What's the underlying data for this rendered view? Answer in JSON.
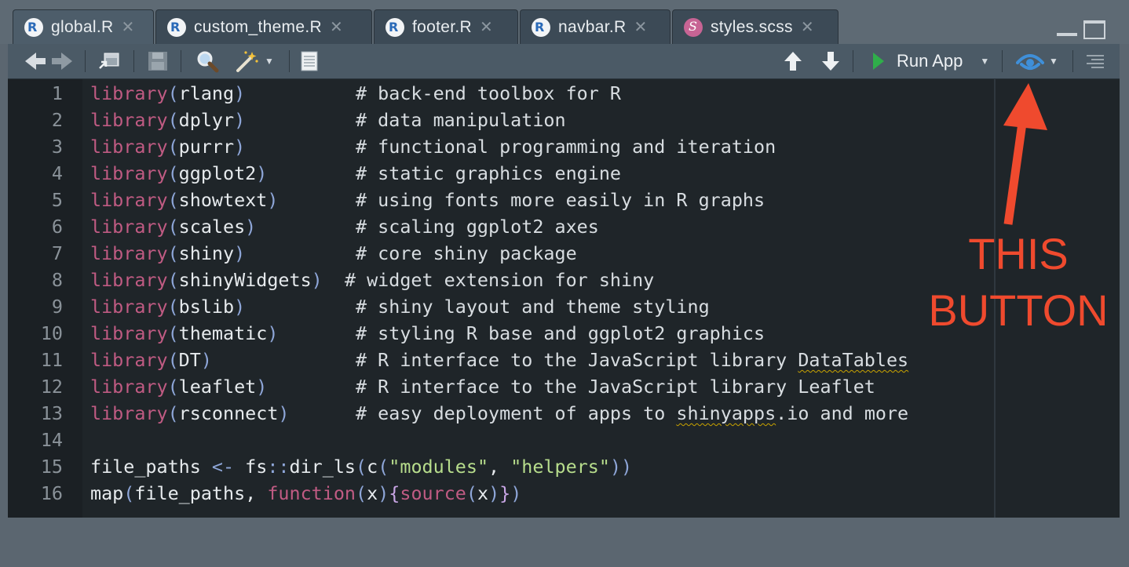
{
  "tabs": [
    {
      "label": "global.R",
      "icon": "r-file-icon",
      "active": true
    },
    {
      "label": "custom_theme.R",
      "icon": "r-file-icon",
      "active": false
    },
    {
      "label": "footer.R",
      "icon": "r-file-icon",
      "active": false
    },
    {
      "label": "navbar.R",
      "icon": "r-file-icon",
      "active": false
    },
    {
      "label": "styles.scss",
      "icon": "sass-file-icon",
      "active": false
    }
  ],
  "toolbar": {
    "run_label": "Run App"
  },
  "editor": {
    "lines": [
      {
        "n": "1",
        "pkg": "rlang",
        "pad": "          ",
        "comment": "# back-end toolbox for R"
      },
      {
        "n": "2",
        "pkg": "dplyr",
        "pad": "          ",
        "comment": "# data manipulation"
      },
      {
        "n": "3",
        "pkg": "purrr",
        "pad": "          ",
        "comment": "# functional programming and iteration"
      },
      {
        "n": "4",
        "pkg": "ggplot2",
        "pad": "        ",
        "comment": "# static graphics engine"
      },
      {
        "n": "5",
        "pkg": "showtext",
        "pad": "       ",
        "comment": "# using fonts more easily in R graphs"
      },
      {
        "n": "6",
        "pkg": "scales",
        "pad": "         ",
        "comment": "# scaling ggplot2 axes"
      },
      {
        "n": "7",
        "pkg": "shiny",
        "pad": "          ",
        "comment": "# core shiny package"
      },
      {
        "n": "8",
        "pkg": "shinyWidgets",
        "pad": "  ",
        "comment": "# widget extension for shiny"
      },
      {
        "n": "9",
        "pkg": "bslib",
        "pad": "          ",
        "comment": "# shiny layout and theme styling"
      },
      {
        "n": "10",
        "pkg": "thematic",
        "pad": "       ",
        "comment": "# styling R base and ggplot2 graphics"
      },
      {
        "n": "11",
        "pkg": "DT",
        "pad": "             ",
        "comment": "# R interface to the JavaScript library ",
        "comment_squiggle": "DataTables"
      },
      {
        "n": "12",
        "pkg": "leaflet",
        "pad": "        ",
        "comment": "# R interface to the JavaScript library Leaflet"
      },
      {
        "n": "13",
        "pkg": "rsconnect",
        "pad": "      ",
        "comment": "# easy deployment of apps to ",
        "comment_squiggle": "shinyapps",
        "comment_tail": ".io and more"
      }
    ],
    "keyword_library": "library",
    "line14": "14",
    "line15": {
      "n": "15",
      "var": "file_paths",
      "assign": " <- ",
      "ns": "fs",
      "nsop": "::",
      "fn": "dir_ls",
      "c": "c",
      "s1": "\"modules\"",
      "comma": ", ",
      "s2": "\"helpers\""
    },
    "line16": {
      "n": "16",
      "map": "map",
      "arg1": "file_paths, ",
      "kw": "function",
      "x": "x",
      "src": "source"
    }
  },
  "annotation": {
    "line1": "THIS",
    "line2": "BUTTON"
  }
}
